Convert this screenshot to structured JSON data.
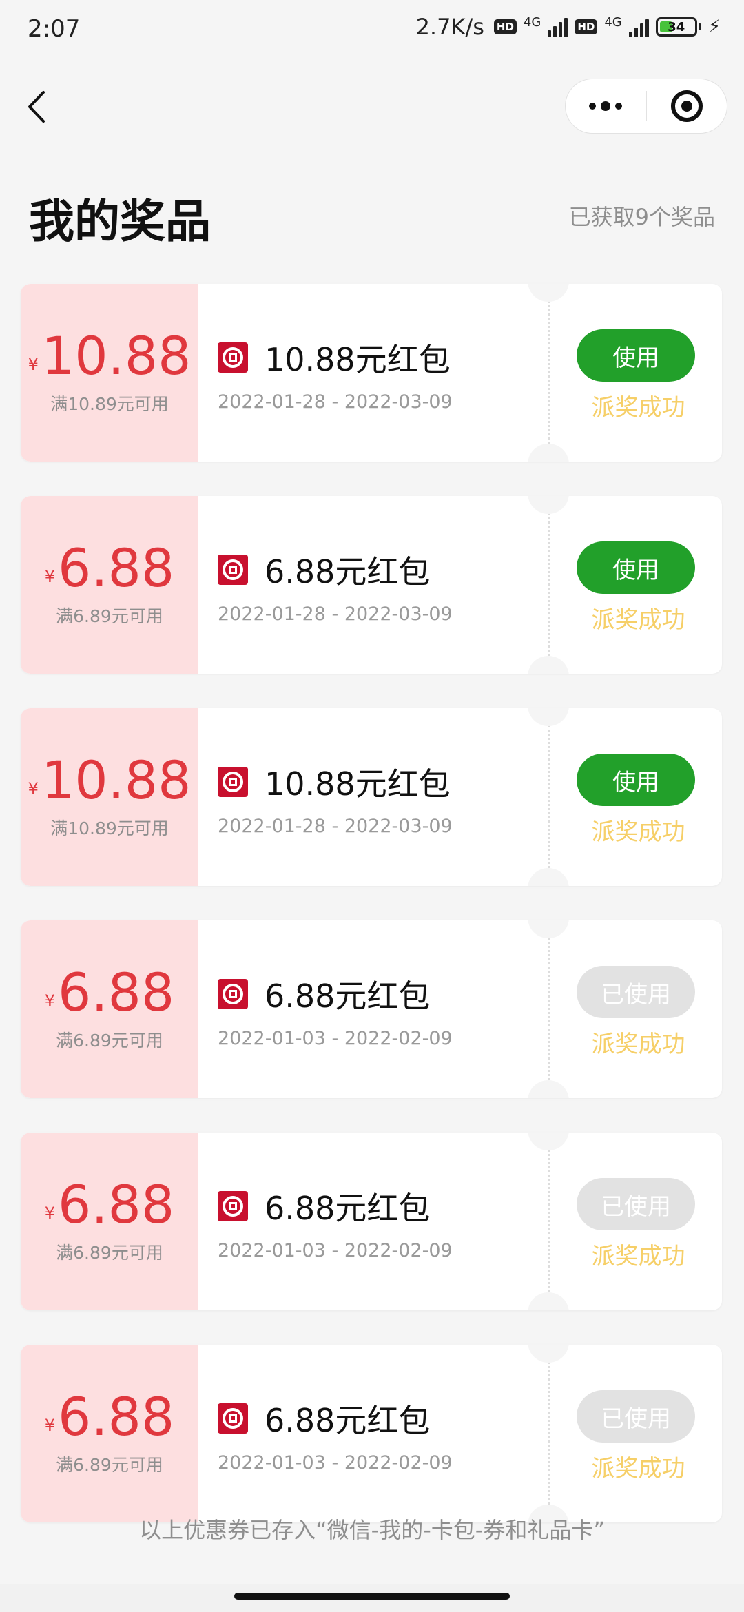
{
  "status_bar": {
    "time": "2:07",
    "net_speed": "2.7K/s",
    "hd_label": "HD",
    "network": "4G",
    "battery": "34"
  },
  "header": {
    "title": "我的奖品",
    "count_text": "已获取9个奖品"
  },
  "coupons": [
    {
      "currency": "¥",
      "amount": "10.88",
      "condition": "满10.89元可用",
      "name": "10.88元红包",
      "dates": "2022-01-28 - 2022-03-09",
      "button": "使用",
      "button_state": "active",
      "status": "派奖成功"
    },
    {
      "currency": "¥",
      "amount": "6.88",
      "condition": "满6.89元可用",
      "name": "6.88元红包",
      "dates": "2022-01-28 - 2022-03-09",
      "button": "使用",
      "button_state": "active",
      "status": "派奖成功"
    },
    {
      "currency": "¥",
      "amount": "10.88",
      "condition": "满10.89元可用",
      "name": "10.88元红包",
      "dates": "2022-01-28 - 2022-03-09",
      "button": "使用",
      "button_state": "active",
      "status": "派奖成功"
    },
    {
      "currency": "¥",
      "amount": "6.88",
      "condition": "满6.89元可用",
      "name": "6.88元红包",
      "dates": "2022-01-03 - 2022-02-09",
      "button": "已使用",
      "button_state": "used",
      "status": "派奖成功"
    },
    {
      "currency": "¥",
      "amount": "6.88",
      "condition": "满6.89元可用",
      "name": "6.88元红包",
      "dates": "2022-01-03 - 2022-02-09",
      "button": "已使用",
      "button_state": "used",
      "status": "派奖成功"
    },
    {
      "currency": "¥",
      "amount": "6.88",
      "condition": "满6.89元可用",
      "name": "6.88元红包",
      "dates": "2022-01-03 - 2022-02-09",
      "button": "已使用",
      "button_state": "used",
      "status": "派奖成功"
    }
  ],
  "footer_note": "以上优惠券已存入“微信-我的-卡包-券和礼品卡”",
  "colors": {
    "amount_red": "#e0383e",
    "amount_panel_bg": "#fddfe0",
    "use_button_green": "#22a02a",
    "used_button_gray": "#e2e2e2",
    "status_yellow": "#f6cf68",
    "page_bg": "#f5f5f5"
  },
  "icons": {
    "back": "chevron-left-icon",
    "more": "more-dots-icon",
    "close": "target-close-icon",
    "bank": "bank-logo-icon"
  }
}
